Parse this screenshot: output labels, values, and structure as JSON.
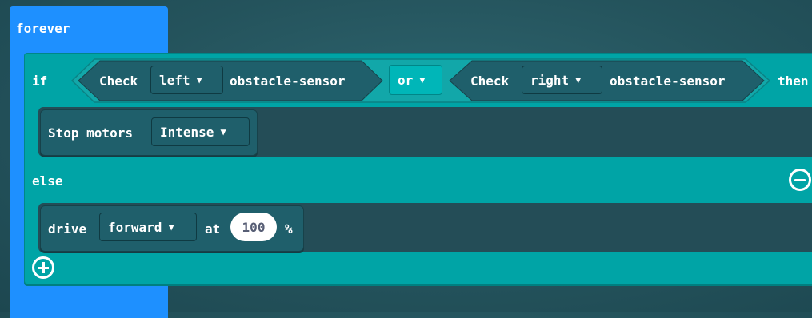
{
  "forever_label": "forever",
  "if_block": {
    "if_label": "if",
    "then_label": "then",
    "else_label": "else",
    "condition": {
      "left": {
        "check_label": "Check",
        "side": "left",
        "sensor_label": "obstacle-sensor"
      },
      "operator": "or",
      "right": {
        "check_label": "Check",
        "side": "right",
        "sensor_label": "obstacle-sensor"
      }
    },
    "then_statement": {
      "label": "Stop motors",
      "mode": "Intense"
    },
    "else_statement": {
      "label": "drive",
      "direction": "forward",
      "at_label": "at",
      "speed": "100",
      "unit": "%"
    }
  },
  "colors": {
    "forever": "#1e90ff",
    "if_block": "#00a4a6",
    "statement": "#1f5f6b",
    "background": "#24535c"
  },
  "icons": {
    "dropdown": "caret-down-icon",
    "remove_else": "minus-circle-icon",
    "add_else": "plus-circle-icon"
  }
}
